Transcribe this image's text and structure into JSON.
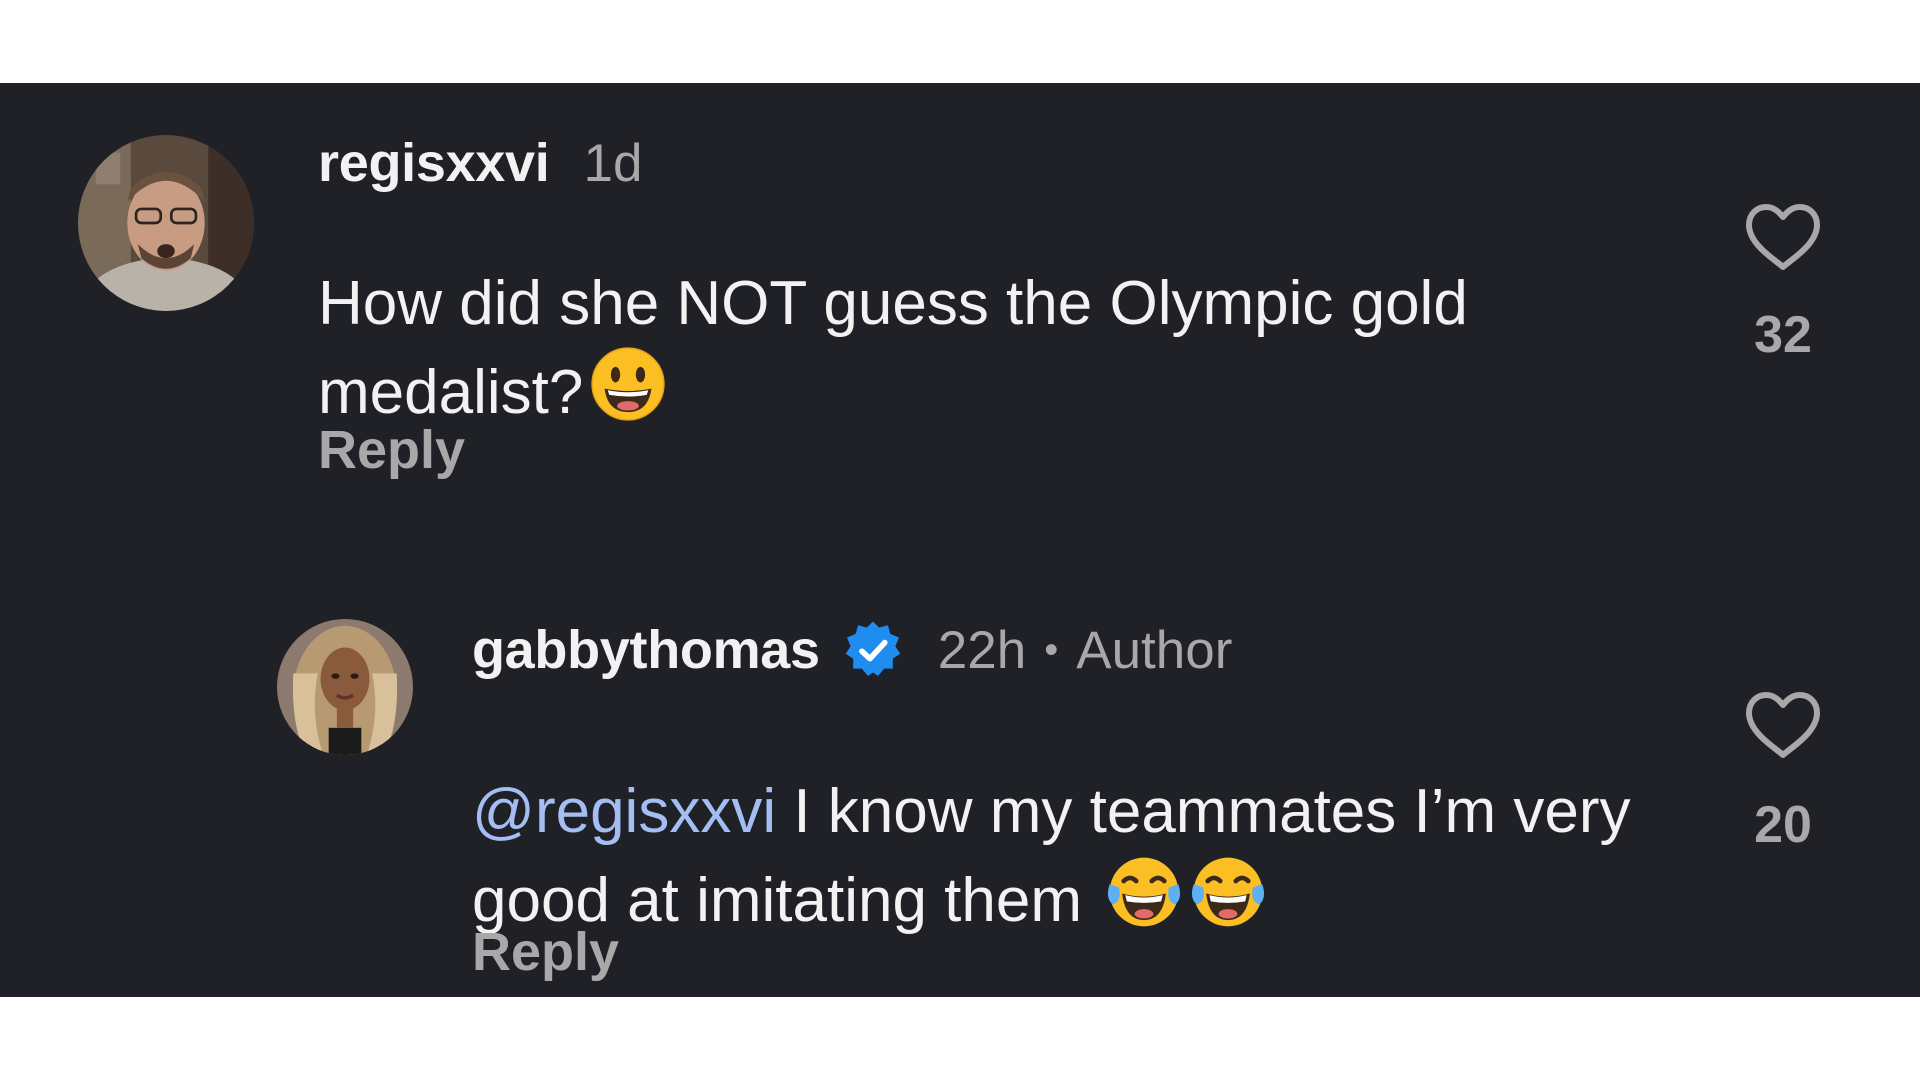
{
  "colors": {
    "background": "#1f2127",
    "username": "#f2f2f2",
    "muted": "#a8a8a8",
    "mention": "#a4bdf2",
    "verified_badge": "#1f8cf0"
  },
  "comments": [
    {
      "username": "regisxxvi",
      "time": "1d",
      "text": "How did she NOT guess the Olympic gold medalist?",
      "emojis": [
        "grinning-face"
      ],
      "reply_label": "Reply",
      "like_count": "32",
      "like_icon": "heart-outline-icon"
    },
    {
      "username": "gabbythomas",
      "verified": true,
      "time": "22h",
      "separator": "•",
      "author_label": "Author",
      "mention": "@regisxxvi",
      "text": " I know my teammates I’m very good at imitating them",
      "emojis": [
        "face-with-tears-of-joy",
        "face-with-tears-of-joy"
      ],
      "reply_label": "Reply",
      "like_count": "20",
      "like_icon": "heart-outline-icon"
    }
  ]
}
